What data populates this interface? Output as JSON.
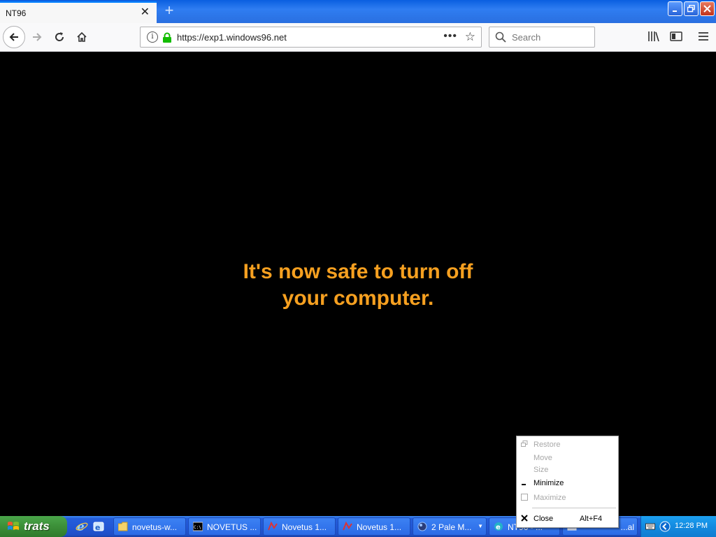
{
  "browser": {
    "tab_title": "NT96",
    "url": "https://exp1.windows96.net",
    "search_placeholder": "Search"
  },
  "content": {
    "message_line1": "It's now safe to turn off",
    "message_line2": "your computer.",
    "message_color": "#f6a020"
  },
  "context_menu": {
    "items": [
      {
        "label": "Restore",
        "enabled": false,
        "icon": "restore-icon"
      },
      {
        "label": "Move",
        "enabled": false
      },
      {
        "label": "Size",
        "enabled": false
      },
      {
        "label": "Minimize",
        "enabled": true,
        "icon": "minimize-icon"
      },
      {
        "label": "Maximize",
        "enabled": false,
        "icon": "maximize-icon"
      },
      {
        "label": "Close",
        "enabled": true,
        "icon": "close-icon",
        "shortcut": "Alt+F4"
      }
    ]
  },
  "taskbar": {
    "start_label": "trats",
    "buttons": [
      {
        "label": "novetus-w...",
        "icon": "folder-icon"
      },
      {
        "label": "NOVETUS ...",
        "icon": "cmd-icon"
      },
      {
        "label": "Novetus 1...",
        "icon": "novetus-icon"
      },
      {
        "label": "Novetus 1...",
        "icon": "novetus-icon"
      },
      {
        "label": "2 Pale M...",
        "icon": "globe-icon"
      },
      {
        "label": "NT96 - ...",
        "icon": "ie-icon"
      },
      {
        "label": "...al",
        "icon": "app-icon"
      }
    ],
    "clock": "12:28 PM"
  }
}
